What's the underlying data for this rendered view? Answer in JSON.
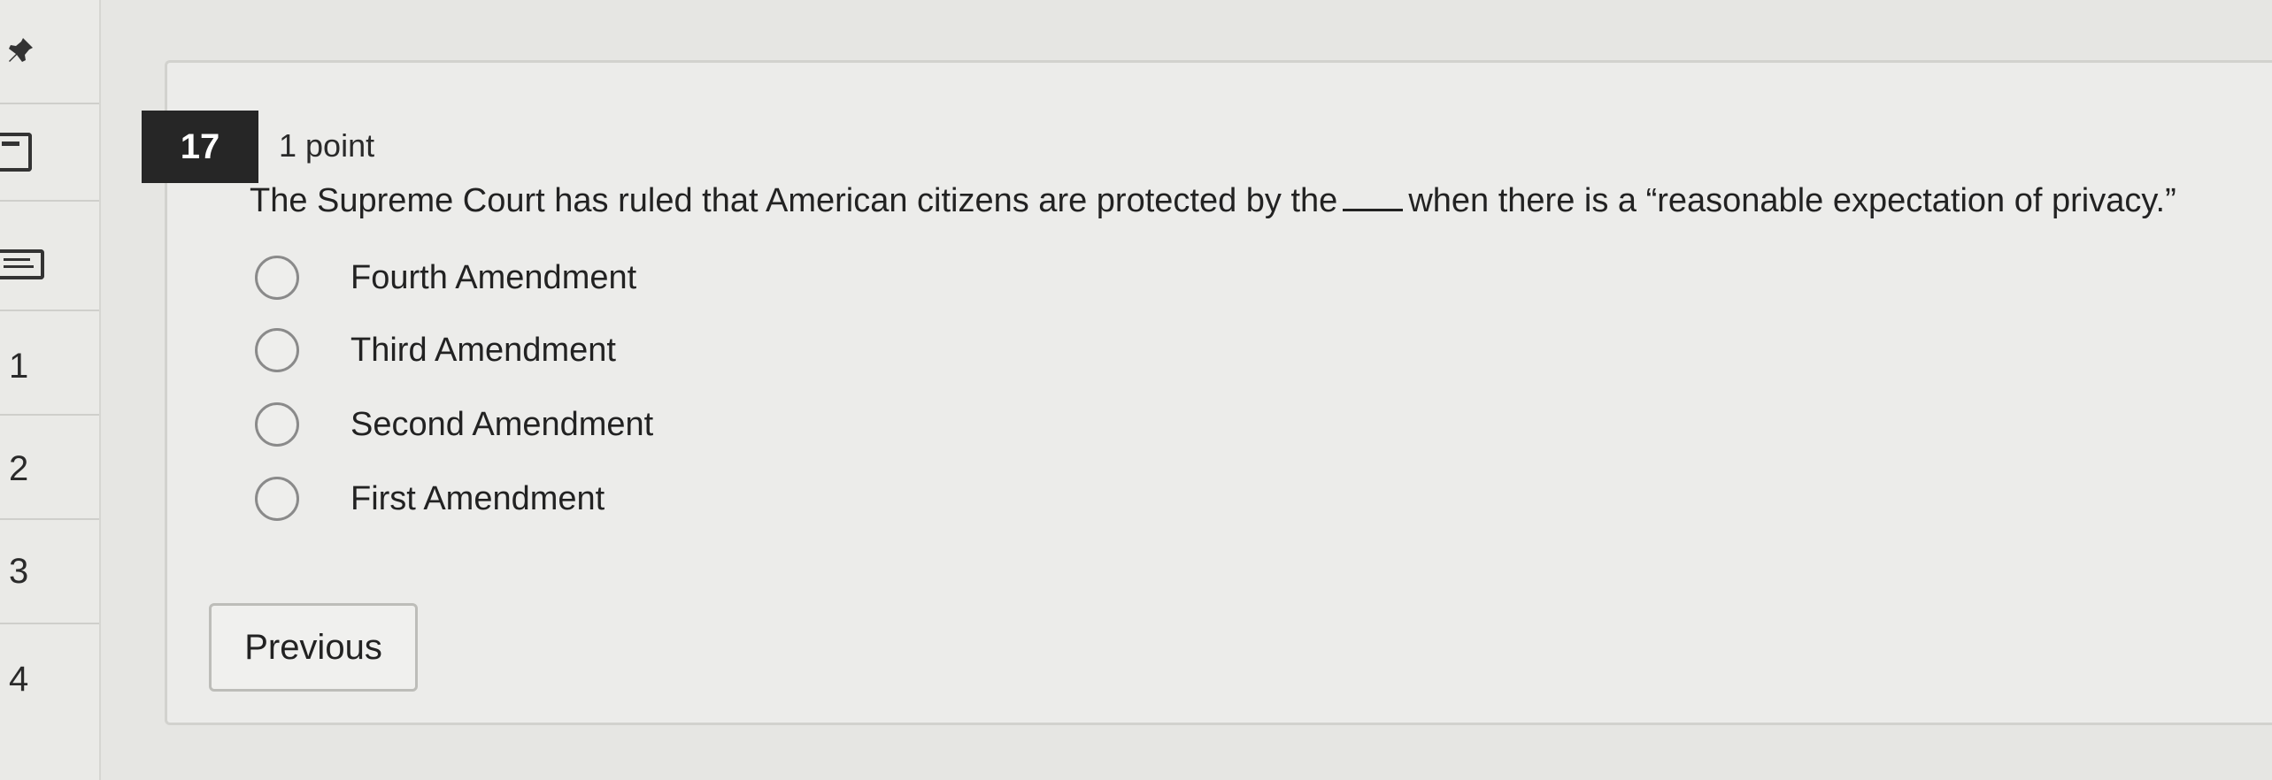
{
  "nav": {
    "items": [
      {
        "label": "1"
      },
      {
        "label": "2"
      },
      {
        "label": "3"
      },
      {
        "label": "4"
      }
    ]
  },
  "question": {
    "number": "17",
    "points": "1 point",
    "text_before": "The Supreme Court has ruled that American citizens are protected by the",
    "text_after": "when there is a “reasonable expectation of privacy.”",
    "options": [
      {
        "label": "Fourth Amendment"
      },
      {
        "label": "Third Amendment"
      },
      {
        "label": "Second Amendment"
      },
      {
        "label": "First Amendment"
      }
    ]
  },
  "footer": {
    "previous_label": "Previous"
  },
  "icons": {
    "pin": "pin-icon",
    "flag": "flag-icon",
    "notes": "notes-icon"
  }
}
